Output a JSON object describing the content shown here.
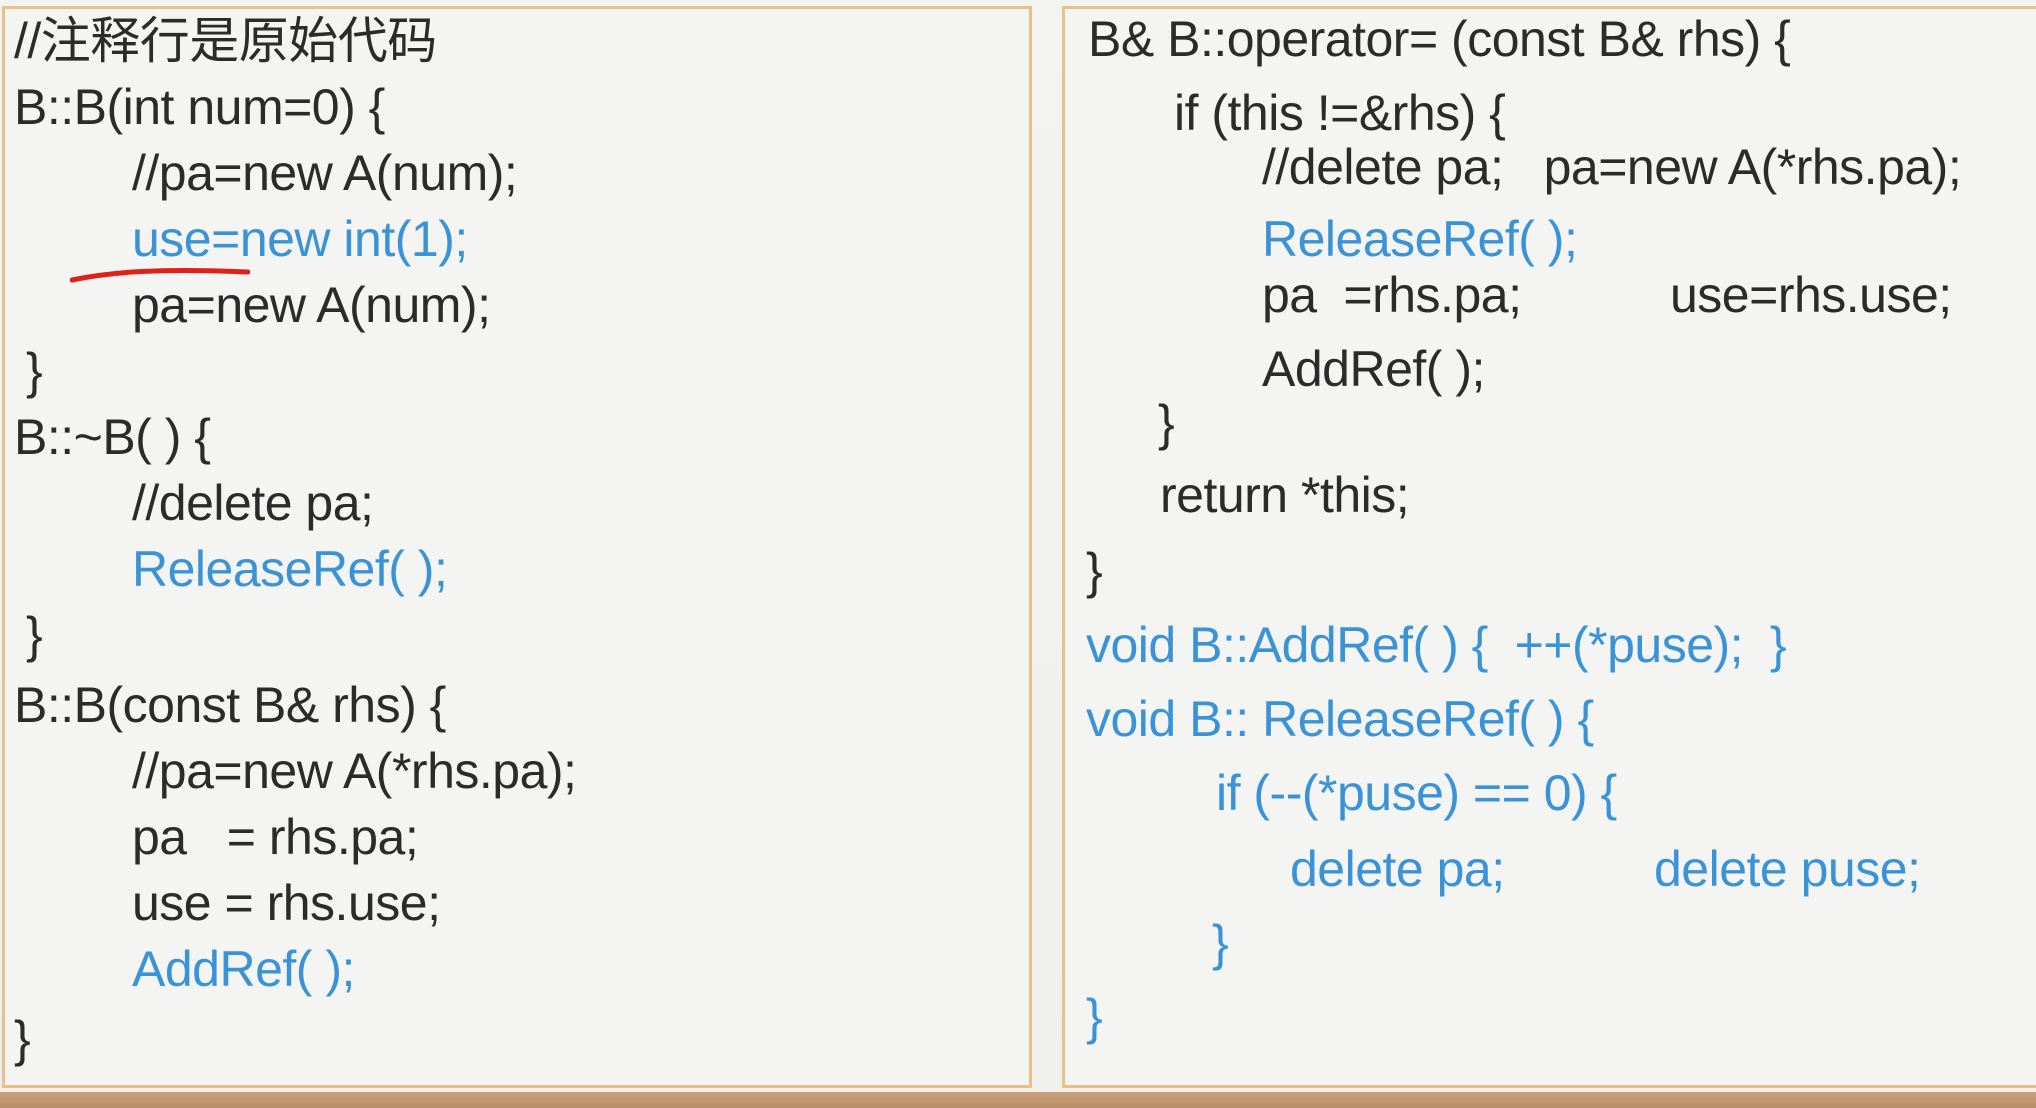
{
  "left_panel": {
    "lines": [
      {
        "text": "//注释行是原始代码",
        "color": "#2b2b2b"
      },
      {
        "text": "B::B(int num=0) {",
        "color": "#2b2b2b"
      },
      {
        "text": "//pa=new A(num);",
        "color": "#2b2b2b"
      },
      {
        "text": "use=new int(1);",
        "color": "#3a93d6"
      },
      {
        "text": "pa=new A(num);",
        "color": "#2b2b2b"
      },
      {
        "text": "}",
        "color": "#2b2b2b"
      },
      {
        "text": "B::~B( ) {",
        "color": "#2b2b2b"
      },
      {
        "text": "//delete pa;",
        "color": "#2b2b2b"
      },
      {
        "text": "ReleaseRef( );",
        "color": "#3a93d6"
      },
      {
        "text": "}",
        "color": "#2b2b2b"
      },
      {
        "text": "B::B(const B& rhs) {",
        "color": "#2b2b2b"
      },
      {
        "text": "//pa=new A(*rhs.pa);",
        "color": "#2b2b2b"
      },
      {
        "text": "pa   = rhs.pa;",
        "color": "#2b2b2b"
      },
      {
        "text": "use = rhs.use;",
        "color": "#2b2b2b"
      },
      {
        "text": "AddRef( );",
        "color": "#3a93d6"
      },
      {
        "text": "}",
        "color": "#2b2b2b"
      }
    ]
  },
  "right_panel": {
    "lines": [
      {
        "text": "B& B::operator= (const B& rhs) {",
        "color": "#2b2b2b"
      },
      {
        "text": "if (this !=&rhs) {",
        "color": "#2b2b2b"
      },
      {
        "text": "//delete pa;   pa=new A(*rhs.pa);",
        "color": "#2b2b2b"
      },
      {
        "text": "ReleaseRef( );",
        "color": "#3a93d6"
      },
      {
        "text": "pa  =rhs.pa;",
        "color": "#2b2b2b"
      },
      {
        "text": "use=rhs.use;",
        "color": "#2b2b2b"
      },
      {
        "text": "AddRef( );",
        "color": "#2b2b2b"
      },
      {
        "text": "}",
        "color": "#2b2b2b"
      },
      {
        "text": "return *this;",
        "color": "#2b2b2b"
      },
      {
        "text": "}",
        "color": "#2b2b2b"
      },
      {
        "text": "void B::AddRef( ) {  ++(*puse);  }",
        "color": "#3a93d6"
      },
      {
        "text": "void B:: ReleaseRef( ) {",
        "color": "#3a93d6"
      },
      {
        "text": "if (--(*puse) == 0) {",
        "color": "#3a93d6"
      },
      {
        "text": "delete pa;",
        "color": "#3a93d6"
      },
      {
        "text": "delete puse;",
        "color": "#3a93d6"
      },
      {
        "text": "}",
        "color": "#3a93d6"
      },
      {
        "text": "}",
        "color": "#3a93d6"
      }
    ]
  },
  "annotation": {
    "underline_color": "#e0211b"
  },
  "theme": {
    "panel_border": "#e7c187",
    "text_dark": "#2b2b2b",
    "text_blue": "#3a93d6"
  }
}
